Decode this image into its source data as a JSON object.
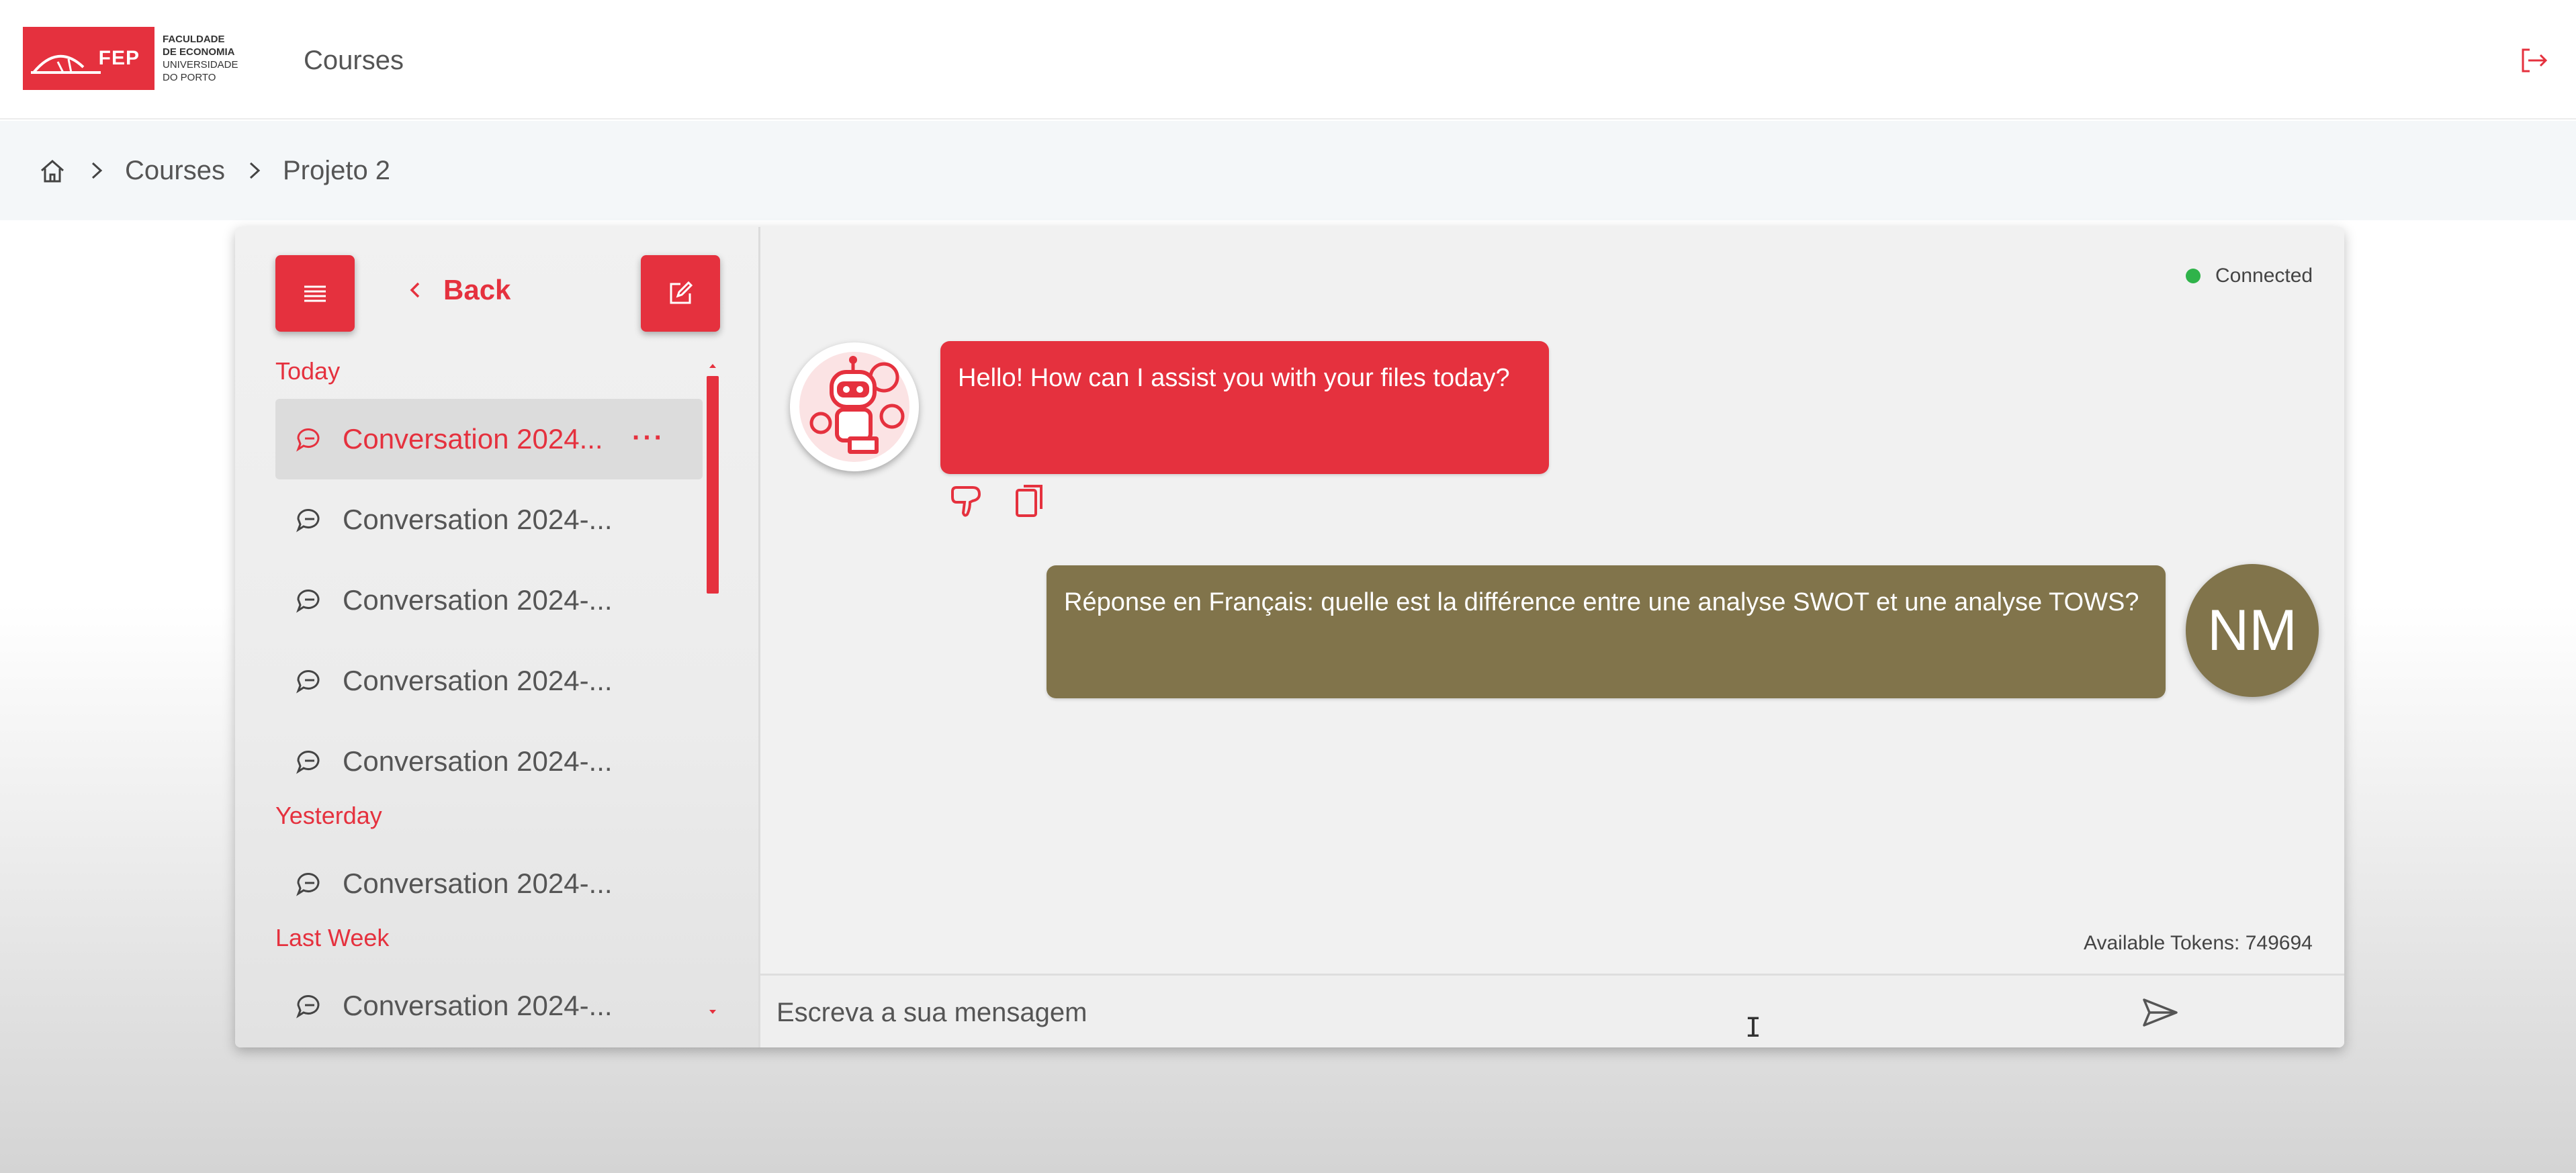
{
  "header": {
    "logo": {
      "abbr": "FEP",
      "lines": [
        "FACULDADE",
        "DE ECONOMIA",
        "UNIVERSIDADE",
        "DO PORTO"
      ]
    },
    "nav_title": "Courses",
    "logout_icon": "logout-icon"
  },
  "breadcrumb": {
    "home_icon": "home-icon",
    "items": [
      "Courses",
      "Projeto 2"
    ]
  },
  "sidebar": {
    "back_label": "Back",
    "sections": [
      {
        "label": "Today",
        "items": [
          {
            "label": "Conversation 2024...",
            "active": true
          },
          {
            "label": "Conversation 2024-..."
          },
          {
            "label": "Conversation 2024-..."
          },
          {
            "label": "Conversation 2024-..."
          },
          {
            "label": "Conversation 2024-..."
          }
        ]
      },
      {
        "label": "Yesterday",
        "items": [
          {
            "label": "Conversation 2024-..."
          }
        ]
      },
      {
        "label": "Last Week",
        "items": [
          {
            "label": "Conversation 2024-..."
          }
        ]
      }
    ],
    "more_label": "···"
  },
  "chat": {
    "status": "Connected",
    "messages": [
      {
        "role": "assistant",
        "text": "Hello! How can I assist you with your files today?"
      },
      {
        "role": "user",
        "text": "Réponse en Français: quelle est la différence entre une analyse SWOT et une analyse TOWS?",
        "avatar": "NM"
      }
    ],
    "tokens": "Available Tokens: 749694",
    "input_placeholder": "Escreva a sua mensagem"
  },
  "colors": {
    "brand_red": "#e5313e",
    "user_bubble": "#81744b",
    "status_green": "#2fb34a"
  }
}
